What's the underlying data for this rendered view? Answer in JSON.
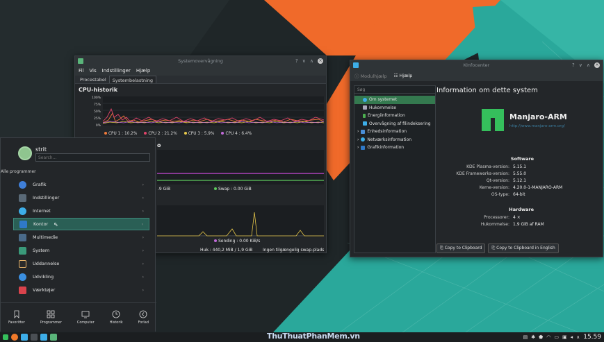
{
  "colors": {
    "accent": "#3daee9",
    "manjaro_green": "#35bf5c",
    "selection": "#2a5f55",
    "wall_orange": "#f06a2a",
    "wall_teal": "#2aa89b"
  },
  "system_monitor": {
    "title": "Systemovervågning",
    "menu": [
      "Fil",
      "Vis",
      "Indstillinger",
      "Hjælp"
    ],
    "tabs": [
      "Procestabel",
      "Systembelastning"
    ],
    "cpu_heading": "CPU-historik",
    "y_ticks": [
      "100%",
      "75%",
      "50%",
      "25%",
      "0%"
    ],
    "cpu_legend": [
      "CPU 1 : 10.2%",
      "CPU 2 : 21.2%",
      "CPU 3 : 5.9%",
      "CPU 4 : 6.4%"
    ],
    "memory_heading_fragment": "o",
    "mem_value_fragment": ".9 GiB",
    "swap_label": "Swap : 0.00 GiB",
    "sending_label": "Sending : 0.00 KiB/s",
    "status_mem": "Huk.: 440,2 MiB / 1,9 GiB",
    "status_swap": "Ingen tilgængelig swap-plads"
  },
  "info_center": {
    "title": "KInfocenter",
    "toolbar": [
      "Modulhjælp",
      "Hjælp"
    ],
    "search_placeholder": "Søg",
    "tree": [
      {
        "label": "Om systemet",
        "level": 1,
        "selected": true,
        "icon": "info-icon"
      },
      {
        "label": "Hukommelse",
        "level": 1,
        "selected": false,
        "icon": "memory-icon"
      },
      {
        "label": "Energiinformation",
        "level": 1,
        "selected": false,
        "icon": "battery-icon"
      },
      {
        "label": "Overvågning af filindeksering",
        "level": 1,
        "selected": false,
        "icon": "file-index-icon"
      },
      {
        "label": "Enhedsinformation",
        "level": 0,
        "selected": false,
        "icon": "device-icon"
      },
      {
        "label": "Netværksinformation",
        "level": 0,
        "selected": false,
        "icon": "network-icon"
      },
      {
        "label": "Grafikinformation",
        "level": 0,
        "selected": false,
        "icon": "graphics-icon"
      }
    ],
    "heading": "Information om dette system",
    "distro_name": "Manjaro-ARM",
    "distro_url": "http://www.manjaro-arm.org/",
    "software_heading": "Software",
    "software": [
      {
        "k": "KDE Plasma-version:",
        "v": "5.15.1"
      },
      {
        "k": "KDE Frameworks-version:",
        "v": "5.55.0"
      },
      {
        "k": "Qt-version:",
        "v": "5.12.1"
      },
      {
        "k": "Kerne-version:",
        "v": "4.20.0-1-MANJARO-ARM"
      },
      {
        "k": "OS-type:",
        "v": "64-bit"
      }
    ],
    "hardware_heading": "Hardware",
    "hardware": [
      {
        "k": "Processorer:",
        "v": "4 ×"
      },
      {
        "k": "Hukommelse:",
        "v": "1,9 GiB af RAM"
      }
    ],
    "copy_button": "Copy to Clipboard",
    "copy_en_button": "Copy to Clipboard in English"
  },
  "launcher": {
    "username": "strit",
    "search_placeholder": "Search...",
    "all_programs": "Alle programmer",
    "categories": [
      {
        "label": "Grafik",
        "icon": "graphics-icon",
        "color": "#3f7fd8"
      },
      {
        "label": "Indstillinger",
        "icon": "settings-icon",
        "color": "#5a6a78"
      },
      {
        "label": "Internet",
        "icon": "internet-icon",
        "color": "#3daee9"
      },
      {
        "label": "Kontor",
        "icon": "office-icon",
        "color": "#2f79c8",
        "selected": true
      },
      {
        "label": "Multimedie",
        "icon": "multimedia-icon",
        "color": "#4a6b8a"
      },
      {
        "label": "System",
        "icon": "system-icon",
        "color": "#3a9a7a"
      },
      {
        "label": "Uddannelse",
        "icon": "education-icon",
        "color": "#e8b46a"
      },
      {
        "label": "Udvikling",
        "icon": "development-icon",
        "color": "#3b8fe0"
      },
      {
        "label": "Værktøjer",
        "icon": "tools-icon",
        "color": "#d9434c"
      }
    ],
    "bottom": [
      "Favoritter",
      "Programmer",
      "Computer",
      "Historik",
      "Forlad"
    ]
  },
  "taskbar": {
    "clock": "15.59",
    "watermark": "ThuThuatPhanMem.vn"
  }
}
